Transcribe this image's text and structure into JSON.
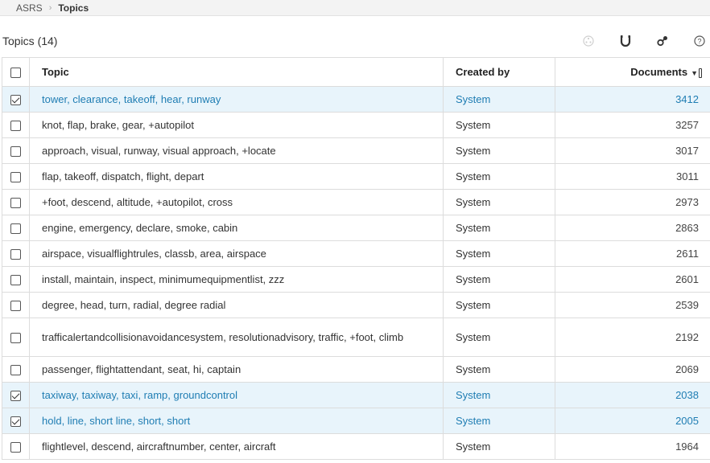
{
  "breadcrumb": {
    "root": "ASRS",
    "current": "Topics"
  },
  "header": {
    "title": "Topics (14)"
  },
  "toolbar": {
    "icons": [
      "dots-icon",
      "magnet-icon",
      "merge-icon",
      "help-icon"
    ]
  },
  "columns": {
    "topic": "Topic",
    "created_by": "Created by",
    "documents": "Documents"
  },
  "rows": [
    {
      "topic": "tower, clearance, takeoff, hear, runway",
      "created_by": "System",
      "documents": "3412",
      "checked": true
    },
    {
      "topic": "knot, flap, brake, gear, +autopilot",
      "created_by": "System",
      "documents": "3257",
      "checked": false
    },
    {
      "topic": "approach, visual, runway, visual approach, +locate",
      "created_by": "System",
      "documents": "3017",
      "checked": false
    },
    {
      "topic": "flap, takeoff, dispatch, flight, depart",
      "created_by": "System",
      "documents": "3011",
      "checked": false
    },
    {
      "topic": "+foot, descend, altitude, +autopilot, cross",
      "created_by": "System",
      "documents": "2973",
      "checked": false
    },
    {
      "topic": "engine, emergency, declare, smoke, cabin",
      "created_by": "System",
      "documents": "2863",
      "checked": false
    },
    {
      "topic": "airspace, visualflightrules, classb, area, airspace",
      "created_by": "System",
      "documents": "2611",
      "checked": false
    },
    {
      "topic": "install, maintain, inspect, minimumequipmentlist, zzz",
      "created_by": "System",
      "documents": "2601",
      "checked": false
    },
    {
      "topic": "degree, head, turn, radial, degree radial",
      "created_by": "System",
      "documents": "2539",
      "checked": false
    },
    {
      "topic": "trafficalertandcollisionavoidancesystem, resolutionadvisory, traffic, +foot, climb",
      "created_by": "System",
      "documents": "2192",
      "checked": false
    },
    {
      "topic": "passenger, flightattendant, seat, hi, captain",
      "created_by": "System",
      "documents": "2069",
      "checked": false
    },
    {
      "topic": "taxiway, taxiway, taxi, ramp, groundcontrol",
      "created_by": "System",
      "documents": "2038",
      "checked": true
    },
    {
      "topic": "hold, line, short line, short, short",
      "created_by": "System",
      "documents": "2005",
      "checked": true
    },
    {
      "topic": "flightlevel, descend, aircraftnumber, center, aircraft",
      "created_by": "System",
      "documents": "1964",
      "checked": false
    }
  ]
}
